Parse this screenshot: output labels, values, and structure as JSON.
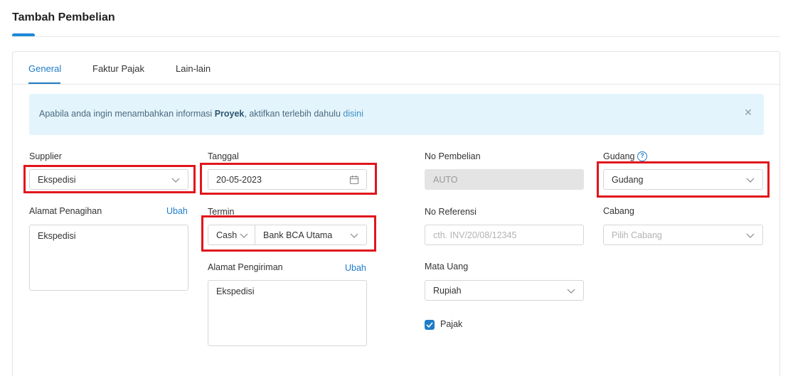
{
  "page": {
    "title": "Tambah Pembelian"
  },
  "tabs": [
    {
      "label": "General",
      "active": true
    },
    {
      "label": "Faktur Pajak",
      "active": false
    },
    {
      "label": "Lain-lain",
      "active": false
    }
  ],
  "alert": {
    "text_before": "Apabila anda ingin menambahkan informasi ",
    "text_bold": "Proyek",
    "text_after": ", aktifkan terlebih dahulu ",
    "link": "disini"
  },
  "form": {
    "supplier": {
      "label": "Supplier",
      "value": "Ekspedisi"
    },
    "tanggal": {
      "label": "Tanggal",
      "value": "20-05-2023"
    },
    "no_pembelian": {
      "label": "No Pembelian",
      "value": "AUTO"
    },
    "gudang": {
      "label": "Gudang",
      "value": "Gudang"
    },
    "alamat_penagihan": {
      "label": "Alamat Penagihan",
      "link": "Ubah",
      "value": "Ekspedisi"
    },
    "termin": {
      "label": "Termin",
      "type_value": "Cash",
      "account_value": "Bank BCA Utama"
    },
    "no_referensi": {
      "label": "No Referensi",
      "placeholder": "cth. INV/20/08/12345"
    },
    "cabang": {
      "label": "Cabang",
      "placeholder": "Pilih Cabang"
    },
    "alamat_pengiriman": {
      "label": "Alamat Pengiriman",
      "link": "Ubah",
      "value": "Ekspedisi"
    },
    "mata_uang": {
      "label": "Mata Uang",
      "value": "Rupiah"
    },
    "pajak": {
      "label": "Pajak",
      "checked": true
    }
  },
  "colors": {
    "accent": "#1e7cc9",
    "highlight": "#e0161c",
    "alert_bg": "#e4f4fc"
  }
}
